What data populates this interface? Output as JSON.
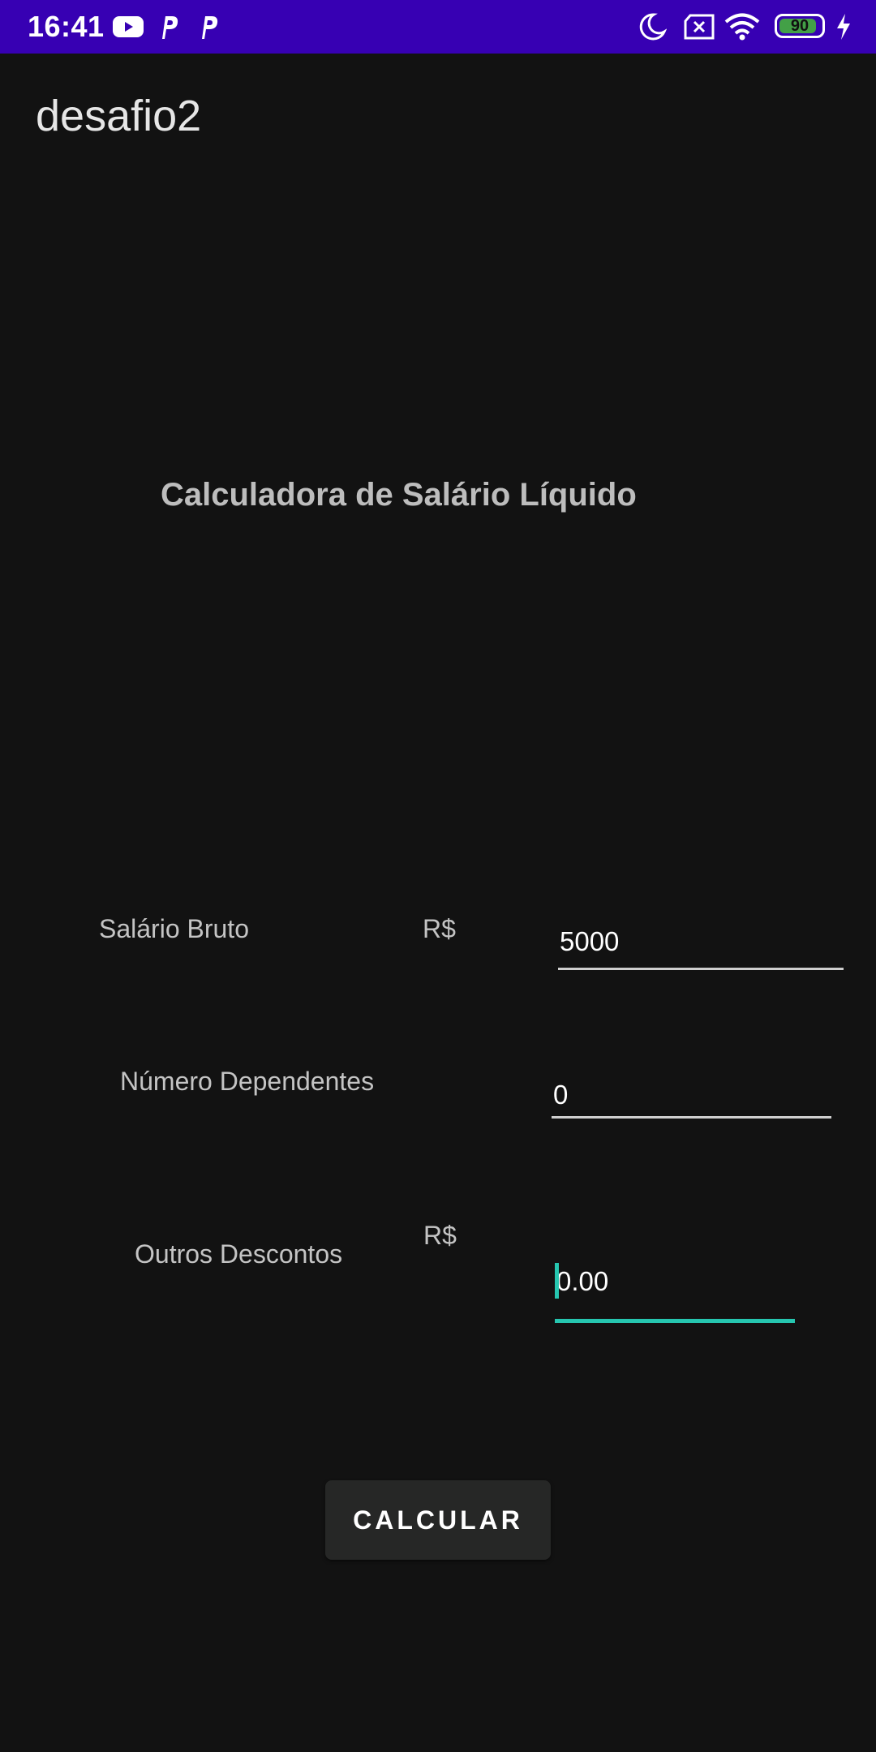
{
  "status_bar": {
    "time": "16:41",
    "battery_level": "90",
    "battery_fraction": 0.9,
    "color": "#3700b3",
    "icons": [
      "youtube-icon",
      "p-app-icon",
      "p-app-icon",
      "moon-icon",
      "sim-x-icon",
      "wifi-icon",
      "battery-icon",
      "charging-icon"
    ]
  },
  "app_bar": {
    "title": "desafio2"
  },
  "main": {
    "heading": "Calculadora de Salário Líquido",
    "fields": {
      "salario": {
        "label": "Salário Bruto",
        "currency": "R$",
        "value": "5000"
      },
      "dependentes": {
        "label": "Número Dependentes",
        "value": "0"
      },
      "descontos": {
        "label": "Outros Descontos",
        "currency": "R$",
        "value": "0.00",
        "focused": true
      }
    },
    "button": {
      "label": "CALCULAR"
    }
  },
  "colors": {
    "accent": "#26c6b0",
    "background": "#121212",
    "button": "#262726"
  }
}
